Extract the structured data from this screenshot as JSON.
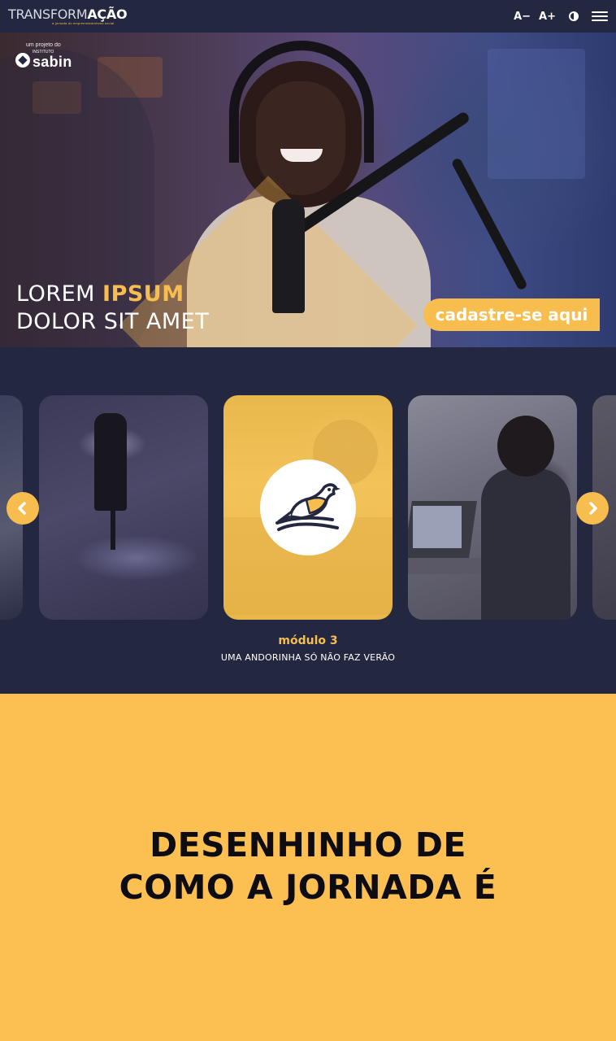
{
  "header": {
    "logo_part1": "TRANSFORM",
    "logo_part2": "AÇÃO",
    "logo_tagline": "a jornada do empreendedorismo social",
    "font_decrease_label": "A−",
    "font_increase_label": "A+",
    "contrast_icon": "contrast-icon",
    "menu_icon": "hamburger-menu-icon"
  },
  "hero": {
    "badge_small": "um projeto do",
    "badge_inst": "INSTITUTO",
    "badge_brand": "sabin",
    "title_line1_normal": "LOREM ",
    "title_line1_highlight": "IPSUM",
    "title_line2": "DOLOR SIT AMET",
    "cta_label": "cadastre-se aqui"
  },
  "modules": {
    "prev_icon": "chevron-left-icon",
    "next_icon": "chevron-right-icon",
    "active_icon": "bird-icon",
    "active_label": "módulo 3",
    "active_title": "UMA ANDORINHA SÓ NÃO FAZ VERÃO"
  },
  "journey": {
    "title_line1": "DESENHINHO DE",
    "title_line2": "COMO A JORNADA É"
  },
  "colors": {
    "navy": "#232840",
    "accent_yellow": "#f8bd4f",
    "section_yellow": "#fbbf52"
  }
}
